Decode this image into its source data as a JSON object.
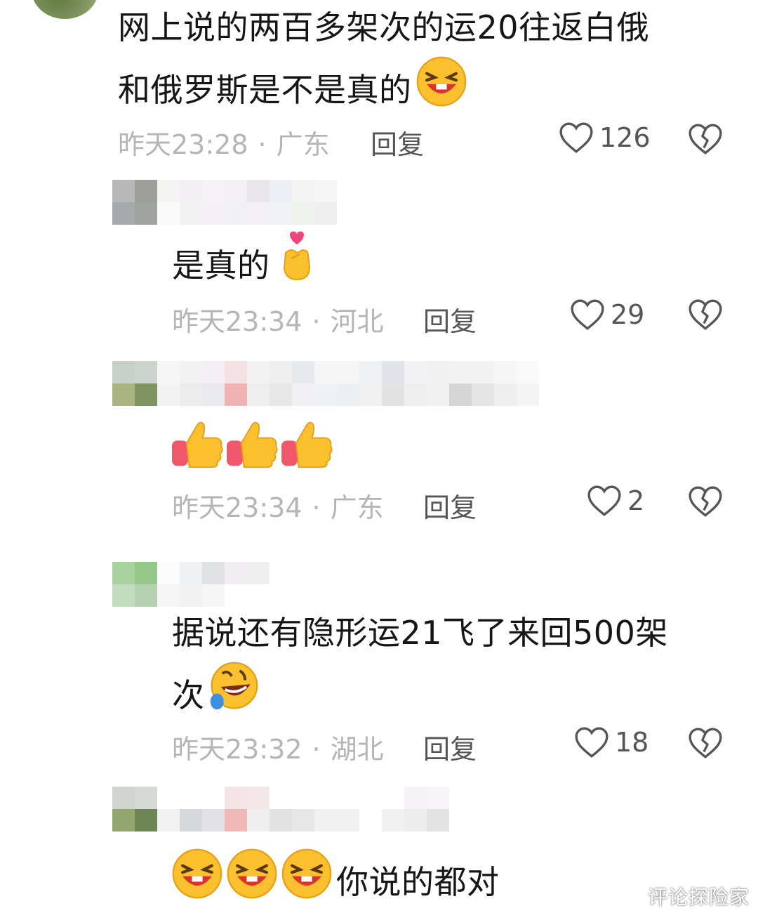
{
  "comments": [
    {
      "text_lines": [
        "网上说的两百多架次的运20往返白俄",
        "和俄罗斯是不是真的"
      ],
      "trailing_emoji": "grin-squint-icon",
      "time": "昨天23:28",
      "separator": "·",
      "location": "广东",
      "reply_label": "回复",
      "likes": "126"
    },
    {
      "text_lines": [
        "是真的"
      ],
      "trailing_emoji": "finger-heart-icon",
      "time": "昨天23:34",
      "separator": "·",
      "location": "河北",
      "reply_label": "回复",
      "likes": "29"
    },
    {
      "text_lines": [
        ""
      ],
      "trailing_emoji": "thumbs-up-icon",
      "time": "昨天23:34",
      "separator": "·",
      "location": "广东",
      "reply_label": "回复",
      "likes": "2"
    },
    {
      "text_lines": [
        "据说还有隐形运21飞了来回500架",
        "次"
      ],
      "trailing_emoji": "rolling-laughing-icon",
      "time": "昨天23:32",
      "separator": "·",
      "location": "湖北",
      "reply_label": "回复",
      "likes": "18"
    },
    {
      "text_lines": [
        "你说的都对"
      ],
      "leading_emoji": "grin-squint-icon",
      "time": "",
      "location": "",
      "reply_label": "",
      "likes": ""
    }
  ],
  "watermark": "评论探险家",
  "colors": {
    "text": "#161616",
    "meta": "#b5b5b5",
    "action": "#555555"
  }
}
